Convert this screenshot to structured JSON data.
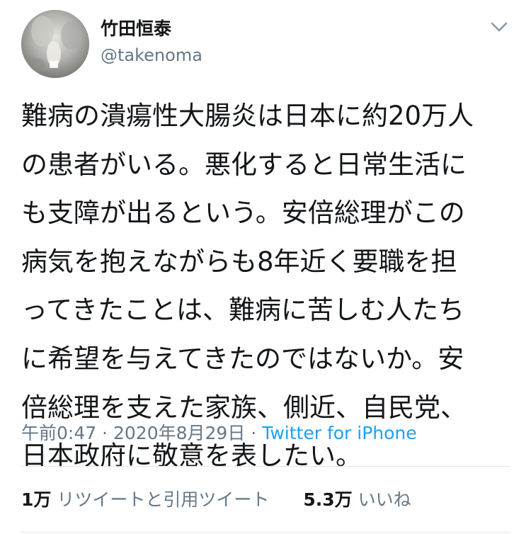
{
  "user": {
    "display_name": "竹田恒泰",
    "handle": "@takenoma",
    "avatar_icon": "profile-photo"
  },
  "tweet": {
    "text": "難病の潰瘍性大腸炎は日本に約20万人\nの患者がいる。悪化すると日常生活に\nも支障が出るという。安倍総理がこの\n病気を抱えながらも8年近く要職を担\nってきたことは、難病に苦しむ人たち\nに希望を与えてきたのではないか。安\n倍総理を支えた家族、側近、自民党、\n日本政府に敬意を表したい。",
    "time": "午前0:47",
    "separator": "·",
    "date": "2020年8月29日",
    "source": "Twitter for iPhone"
  },
  "stats": {
    "retweets_count": "1万",
    "retweets_label": "リツイートと引用ツイート",
    "likes_count": "5.3万",
    "likes_label": "いいね"
  },
  "colors": {
    "text_primary": "#14171a",
    "text_secondary": "#657786",
    "link": "#1da1f2",
    "divider": "#e1e8ed"
  }
}
